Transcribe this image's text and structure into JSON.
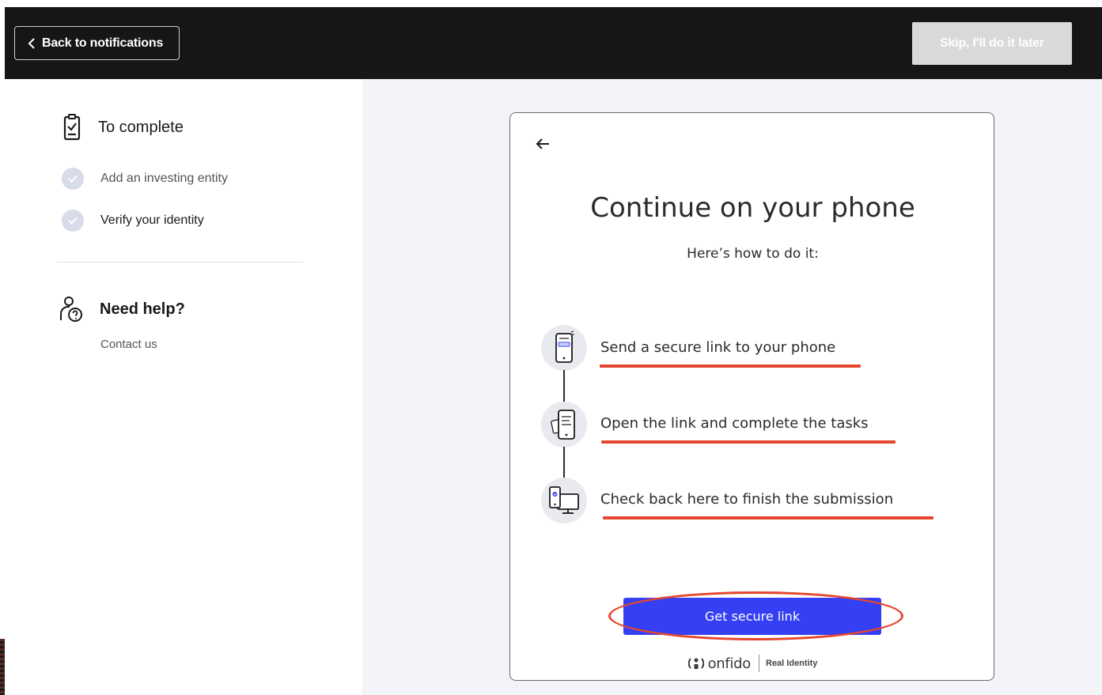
{
  "topbar": {
    "back_label": "Back to notifications",
    "skip_label": "Skip, I'll do it later"
  },
  "sidebar": {
    "todo_title": "To complete",
    "steps": [
      {
        "label": "Add an investing entity",
        "color": "#555555"
      },
      {
        "label": "Verify your identity",
        "color": "#1a1a1a"
      }
    ],
    "help_title": "Need help?",
    "contact_label": "Contact us"
  },
  "card": {
    "title": "Continue on your phone",
    "subtitle": "Here’s how to do it:",
    "steps": [
      {
        "text": "Send a secure link to your phone",
        "icon": "phone-link-icon"
      },
      {
        "text": "Open the link and complete the tasks",
        "icon": "phone-document-icon"
      },
      {
        "text": "Check back here to finish the submission",
        "icon": "phone-desktop-icon"
      }
    ],
    "cta_label": "Get secure link",
    "brand_name": "onfido",
    "brand_tag": "Real Identity"
  },
  "colors": {
    "topbar_bg": "#161616",
    "primary": "#353ff4",
    "annotation_red": "#e5462f",
    "main_bg": "#f3f4f8"
  }
}
